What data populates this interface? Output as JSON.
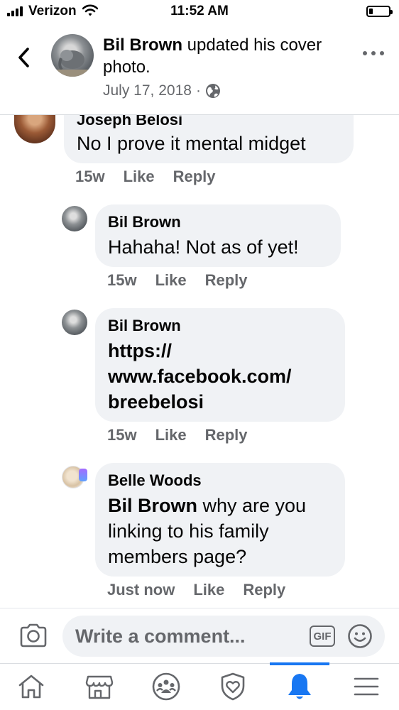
{
  "status_bar": {
    "carrier": "Verizon",
    "time": "11:52 AM",
    "battery_level": 0.18,
    "icons": [
      "signal-icon",
      "wifi-icon",
      "battery-icon"
    ]
  },
  "header": {
    "actor": "Bil Brown",
    "action": " updated his cover photo.",
    "date": "July 17, 2018",
    "separator": "·",
    "icons": [
      "back-icon",
      "globe-icon",
      "more-icon"
    ]
  },
  "comments": [
    {
      "author": "Joseph Belosi",
      "text": "No I prove it mental midget",
      "time": "15w",
      "like": "Like",
      "reply": "Reply"
    },
    {
      "author": "Bil Brown",
      "text": "Hahaha! Not as of yet!",
      "time": "15w",
      "like": "Like",
      "reply": "Reply"
    },
    {
      "author": "Bil Brown",
      "text_lines": [
        "https://",
        "www.facebook.com/",
        "breebelosi"
      ],
      "time": "15w",
      "like": "Like",
      "reply": "Reply"
    },
    {
      "author": "Belle Woods",
      "mention": "Bil Brown",
      "text_lines": [
        " why are you",
        "linking to his family",
        "members page?"
      ],
      "time": "Just now",
      "like": "Like",
      "reply": "Reply"
    }
  ],
  "composer": {
    "placeholder": "Write a comment...",
    "gif_label": "GIF",
    "icons": [
      "camera-icon",
      "emoji-icon"
    ]
  },
  "bottom_nav": {
    "items": [
      "home-icon",
      "marketplace-icon",
      "groups-icon",
      "shield-icon",
      "notifications-icon",
      "menu-icon"
    ],
    "active": "notifications-icon",
    "active_color": "#1877f2"
  }
}
